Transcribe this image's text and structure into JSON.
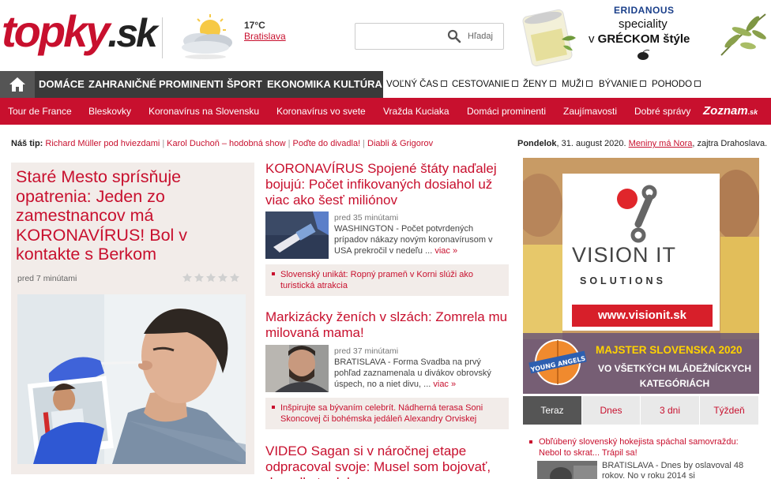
{
  "header": {
    "logo_main": "topky",
    "logo_tld": ".sk",
    "weather": {
      "temp": "17°C",
      "city": "Bratislava",
      "icon": "partly-cloudy-icon"
    },
    "search": {
      "placeholder": "",
      "button_label": "Hľadaj"
    }
  },
  "top_ad": {
    "brand": "ERIDANOUS",
    "line1": "speciality",
    "line2_prefix": "v ",
    "line2_bold": "GRÉCKOM štýle"
  },
  "nav": {
    "main": [
      "DOMÁCE",
      "ZAHRANIČNÉ",
      "PROMINENTI",
      "ŠPORT",
      "EKONOMIKA",
      "KULTÚRA"
    ],
    "external": [
      "VOĽNÝ ČAS",
      "CESTOVANIE",
      "ŽENY",
      "MUŽI",
      "BÝVANIE",
      "POHODO"
    ]
  },
  "subnav": {
    "items": [
      "Tour de France",
      "Bleskovky",
      "Koronavírus na Slovensku",
      "Koronavírus vo svete",
      "Vražda Kuciaka",
      "Domáci prominenti",
      "Zaujímavosti",
      "Dobré správy"
    ],
    "partner": "Zoznam",
    "partner_tld": ".sk"
  },
  "tipbar": {
    "label": "Náš tip:",
    "tips": [
      "Richard Müller pod hviezdami",
      "Karol Duchoň – hodobná show",
      "Poďte do divadla!",
      "Diabli & Grigorov"
    ]
  },
  "datebar": {
    "day": "Pondelok",
    "date": ", 31. august 2020.",
    "nameday_link": "Meniny má Nora",
    "tomorrow": ", zajtra Drahoslava."
  },
  "lead": {
    "headline": "Staré Mesto sprísňuje opatrenia: Jeden zo zamestnancov má KORONAVÍRUS! Bol v kontakte s Berkom",
    "time": "pred 7 minútami",
    "rating": 0
  },
  "articles": [
    {
      "headline": "KORONAVÍRUS Spojené štáty naďalej bojujú: Počet infikovaných dosiahol už viac ako šesť miliónov",
      "time": "pred 35 minútami",
      "place": "WASHINGTON",
      "perex": " - Počet potvrdených prípadov nákazy novým koronavírusom v USA prekročil v nedeľu ...",
      "more": "viac »",
      "related": "Slovenský unikát: Ropný prameň v Korni slúži ako turistická atrakcia"
    },
    {
      "headline": "Markizácky ženích v slzách: Zomrela mu milovaná mama!",
      "time": "pred 37 minútami",
      "place": "BRATISLAVA",
      "perex": " - Forma Svadba na prvý pohľad zaznamenala u divákov obrovský úspech, no a niet divu, ...",
      "more": "viac »",
      "related": "Inšpirujte sa bývaním celebrít. Nádherná terasa Soni Skoncovej či bohémska jedáleň Alexandry Orviskej"
    },
    {
      "headline": "VIDEO Sagan si v náročnej etape odpracoval svoje: Musel som bojovať, dopadlo to dobre"
    }
  ],
  "right_ad": {
    "company_1": "VISION IT",
    "company_2": "SOLUTIONS",
    "url": "www.visionit.sk",
    "badge": "YOUNG ANGELS",
    "claim_1": "MAJSTER SLOVENSKA 2020",
    "claim_2": "VO VŠETKÝCH MLÁDEŽNÍCKYCH KATEGÓRIÁCH"
  },
  "tabs": {
    "items": [
      "Teraz",
      "Dnes",
      "3 dni",
      "Týždeň"
    ],
    "active": 0
  },
  "trending": {
    "headline": "Obľúbený slovenský hokejista spáchal samovraždu: Nebol to skrat... Trápil sa!",
    "place": "BRATISLAVA",
    "perex": " - Dnes by oslavoval 48 rokov. No v roku 2014 si"
  },
  "colors": {
    "brand_red": "#c8102e",
    "nav_dark": "#3a3a3a",
    "light_bg": "#f2ece9"
  }
}
